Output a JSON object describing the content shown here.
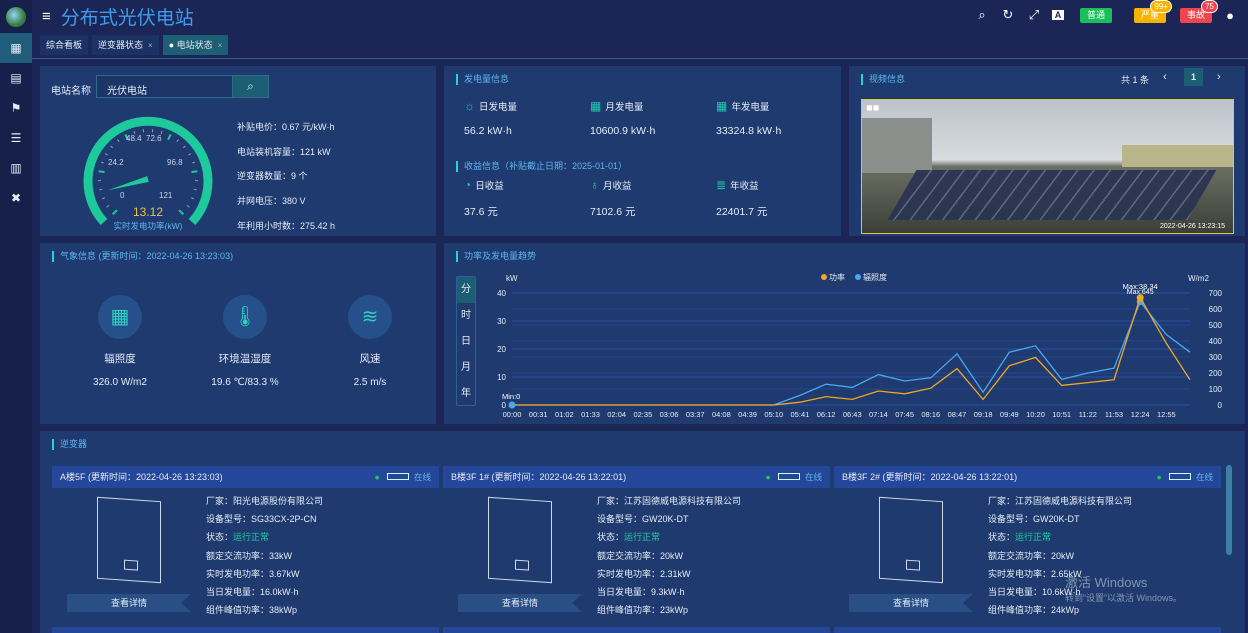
{
  "app": {
    "title": "分布式光伏电站",
    "menu_icon": "hamburger-icon"
  },
  "toolbar": {
    "icons": [
      "search-icon",
      "refresh-icon",
      "fullscreen-icon",
      "font-size-icon",
      "user-icon"
    ],
    "badges": [
      {
        "label": "普通",
        "color": "#19c05a",
        "count": ""
      },
      {
        "label": "严重",
        "color": "#f5b400",
        "count": "99+"
      },
      {
        "label": "事故",
        "color": "#f0454f",
        "count": "75"
      }
    ]
  },
  "sidebar": {
    "icons": [
      "dashboard-icon",
      "inverter-icon",
      "weather-station-icon",
      "list-icon",
      "panel-icon",
      "tools-icon"
    ]
  },
  "tabs": [
    {
      "label": "综合看板",
      "closable": false,
      "active": false
    },
    {
      "label": "逆变器状态",
      "closable": true,
      "active": false
    },
    {
      "label": "电站状态",
      "closable": true,
      "active": true
    }
  ],
  "station": {
    "name_label": "电站名称",
    "name_value": "光伏电站",
    "gauge": {
      "value": "13.12",
      "min": 0,
      "max": 121,
      "ticks": [
        "0",
        "24.2",
        "48.4",
        "72.6",
        "96.8",
        "121"
      ],
      "label": "实时发电功率(kW)"
    },
    "info": [
      "补贴电价：0.67 元/kW·h",
      "电站装机容量：121 kW",
      "逆变器数量：9 个",
      "并网电压：380 V",
      "年利用小时数：275.42 h"
    ]
  },
  "generation": {
    "title": "发电量信息",
    "items": [
      {
        "label": "日发电量",
        "value": "56.2 kW·h",
        "icon": "sun-icon"
      },
      {
        "label": "月发电量",
        "value": "10600.9 kW·h",
        "icon": "calendar-month-icon"
      },
      {
        "label": "年发电量",
        "value": "33324.8 kW·h",
        "icon": "calendar-year-icon"
      }
    ]
  },
  "income": {
    "title": "收益信息（补贴截止日期：2025-01-01）",
    "items": [
      {
        "label": "日收益",
        "value": "37.6 元",
        "icon": "hand-coin-icon"
      },
      {
        "label": "月收益",
        "value": "7102.6 元",
        "icon": "money-bag-icon"
      },
      {
        "label": "年收益",
        "value": "22401.7 元",
        "icon": "coin-stack-icon"
      }
    ]
  },
  "video": {
    "title": "视频信息",
    "total": "共 1 条",
    "page": "1",
    "timestamp": "2022-04-26 13:23:15"
  },
  "weather": {
    "title": "气象信息 (更新时间：2022-04-26 13:23:03)",
    "items": [
      {
        "label": "辐照度",
        "value": "326.0 W/m2",
        "icon": "solar-panel-icon"
      },
      {
        "label": "环境温湿度",
        "value": "19.6 ℃/83.3 %",
        "icon": "thermometer-icon"
      },
      {
        "label": "风速",
        "value": "2.5 m/s",
        "icon": "wind-icon"
      }
    ]
  },
  "trend": {
    "title": "功率及发电量趋势",
    "periods": [
      "分",
      "时",
      "日",
      "月",
      "年"
    ],
    "active_period": "分"
  },
  "chart_data": {
    "type": "line",
    "ylabel": "kW",
    "y2label": "W/m2",
    "ylim": [
      0,
      40
    ],
    "y2lim": [
      0,
      700
    ],
    "yticks": [
      "0",
      "10",
      "20",
      "30",
      "40"
    ],
    "y2ticks": [
      "0",
      "100",
      "200",
      "300",
      "400",
      "500",
      "600",
      "700"
    ],
    "legend": [
      "功率",
      "辐照度"
    ],
    "legend_position": "top-center",
    "grid": true,
    "xticks": [
      "00:00",
      "00:31",
      "01:02",
      "01:33",
      "02:04",
      "02:35",
      "03:06",
      "03:37",
      "04:08",
      "04:39",
      "05:10",
      "05:41",
      "06:12",
      "06:43",
      "07:14",
      "07:45",
      "08:16",
      "08:47",
      "09:18",
      "09:49",
      "10:20",
      "10:51",
      "11:22",
      "11:53",
      "12:24",
      "12:55"
    ],
    "x": [
      "00:00",
      "00:31",
      "01:02",
      "01:33",
      "02:04",
      "02:35",
      "03:06",
      "03:37",
      "04:08",
      "04:39",
      "05:10",
      "05:41",
      "06:12",
      "06:43",
      "07:14",
      "07:45",
      "08:16",
      "08:47",
      "09:18",
      "09:49",
      "10:20",
      "10:51",
      "11:22",
      "11:53",
      "12:24",
      "12:55",
      "13:23"
    ],
    "series": [
      {
        "name": "功率",
        "axis": "left",
        "color": "#f5a623",
        "values": [
          0,
          0,
          0,
          0,
          0,
          0,
          0,
          0,
          0,
          0,
          0,
          1,
          3,
          2,
          5,
          4,
          6,
          13,
          2,
          14,
          17,
          7,
          8,
          9,
          38.34,
          22,
          9
        ]
      },
      {
        "name": "辐照度",
        "axis": "right",
        "color": "#4aa8f0",
        "values": [
          0,
          0,
          0,
          0,
          0,
          0,
          0,
          0,
          0,
          0,
          0,
          60,
          130,
          110,
          190,
          150,
          170,
          320,
          80,
          330,
          370,
          160,
          200,
          230,
          645,
          440,
          330
        ]
      }
    ],
    "annotations": [
      "Max:38.34",
      "Max:645",
      "Min:0"
    ]
  },
  "inverters": {
    "title": "逆变器",
    "status_text": "在线",
    "detail_button": "查看详情",
    "cards": [
      {
        "header": "A楼5F (更新时间：2022-04-26 13:23:03)",
        "fields": [
          "厂家：阳光电源股份有限公司",
          "设备型号：SG33CX-2P-CN"
        ],
        "status_label": "状态：",
        "status": "运行正常",
        "fields2": [
          "额定交流功率：33kW",
          "实时发电功率：3.67kW",
          "当日发电量：16.0kW·h",
          "组件峰值功率：38kWp"
        ]
      },
      {
        "header": "B楼3F 1# (更新时间：2022-04-26 13:22:01)",
        "fields": [
          "厂家：江苏固德威电源科技有限公司",
          "设备型号：GW20K-DT"
        ],
        "status_label": "状态：",
        "status": "运行正常",
        "fields2": [
          "额定交流功率：20kW",
          "实时发电功率：2.31kW",
          "当日发电量：9.3kW·h",
          "组件峰值功率：23kWp"
        ]
      },
      {
        "header": "B楼3F 2# (更新时间：2022-04-26 13:22:01)",
        "fields": [
          "厂家：江苏固德威电源科技有限公司",
          "设备型号：GW20K-DT"
        ],
        "status_label": "状态：",
        "status": "运行正常",
        "fields2": [
          "额定交流功率：20kW",
          "实时发电功率：2.65kW",
          "当日发电量：10.6kW·h",
          "组件峰值功率：24kWp"
        ]
      }
    ]
  },
  "watermark": {
    "line1": "激活 Windows",
    "line2": "转到“设置”以激活 Windows。"
  }
}
